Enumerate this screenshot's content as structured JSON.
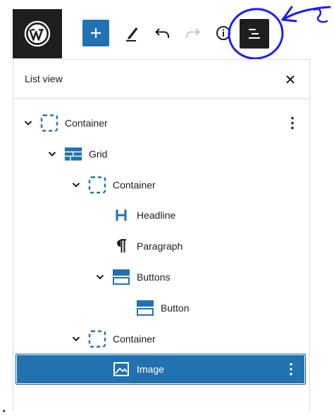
{
  "toolbar": {
    "icons": [
      "wordpress-logo",
      "plus-icon",
      "pen-icon",
      "undo-icon",
      "redo-icon",
      "info-icon",
      "list-view-icon"
    ]
  },
  "colors": {
    "accent": "#2271b1",
    "dark": "#1e1e1e",
    "annotation": "#1a1aff"
  },
  "list_view": {
    "title": "List view",
    "items": [
      {
        "label": "Container",
        "icon": "container-icon",
        "level": 0,
        "expanded": true,
        "selected": false,
        "has_more": true
      },
      {
        "label": "Grid",
        "icon": "grid-icon",
        "level": 1,
        "expanded": true,
        "selected": false,
        "has_more": false
      },
      {
        "label": "Container",
        "icon": "container-icon",
        "level": 2,
        "expanded": true,
        "selected": false,
        "has_more": false
      },
      {
        "label": "Headline",
        "icon": "headline-icon",
        "level": 3,
        "expanded": null,
        "selected": false,
        "has_more": false
      },
      {
        "label": "Paragraph",
        "icon": "paragraph-icon",
        "level": 3,
        "expanded": null,
        "selected": false,
        "has_more": false
      },
      {
        "label": "Buttons",
        "icon": "buttons-icon",
        "level": 3,
        "expanded": true,
        "selected": false,
        "has_more": false
      },
      {
        "label": "Button",
        "icon": "button-icon",
        "level": 4,
        "expanded": null,
        "selected": false,
        "has_more": false
      },
      {
        "label": "Container",
        "icon": "container-icon",
        "level": 2,
        "expanded": true,
        "selected": false,
        "has_more": false
      },
      {
        "label": "Image",
        "icon": "image-icon",
        "level": 3,
        "expanded": null,
        "selected": true,
        "has_more": true
      }
    ]
  }
}
